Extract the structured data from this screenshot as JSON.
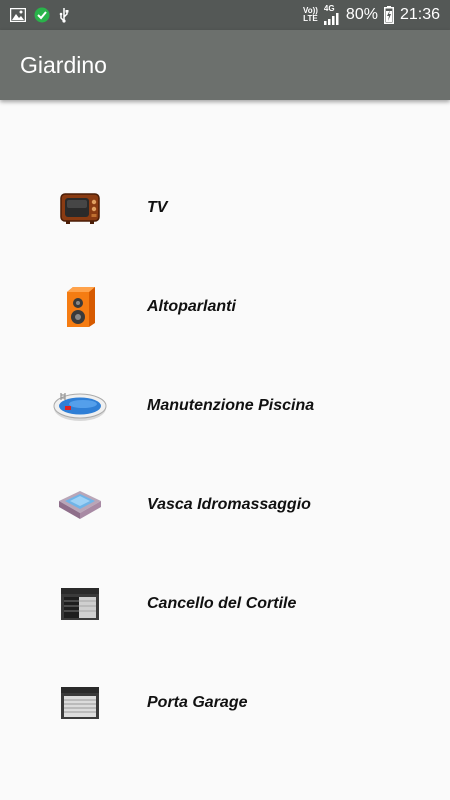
{
  "status_bar": {
    "network_top": "Vo))",
    "network_bottom": "LTE",
    "signal_type": "4G",
    "battery": "80%",
    "time": "21:36",
    "icons": [
      "image-icon",
      "app-icon",
      "usb-icon",
      "volte-icon",
      "signal-icon",
      "battery-charging-icon"
    ]
  },
  "app_bar": {
    "title": "Giardino"
  },
  "items": [
    {
      "label": "TV",
      "icon": "tv-icon"
    },
    {
      "label": "Altoparlanti",
      "icon": "speaker-icon"
    },
    {
      "label": "Manutenzione Piscina",
      "icon": "pool-icon"
    },
    {
      "label": "Vasca Idromassaggio",
      "icon": "hot-tub-icon"
    },
    {
      "label": "Cancello del Cortile",
      "icon": "gate-icon"
    },
    {
      "label": "Porta Garage",
      "icon": "garage-door-icon"
    }
  ]
}
